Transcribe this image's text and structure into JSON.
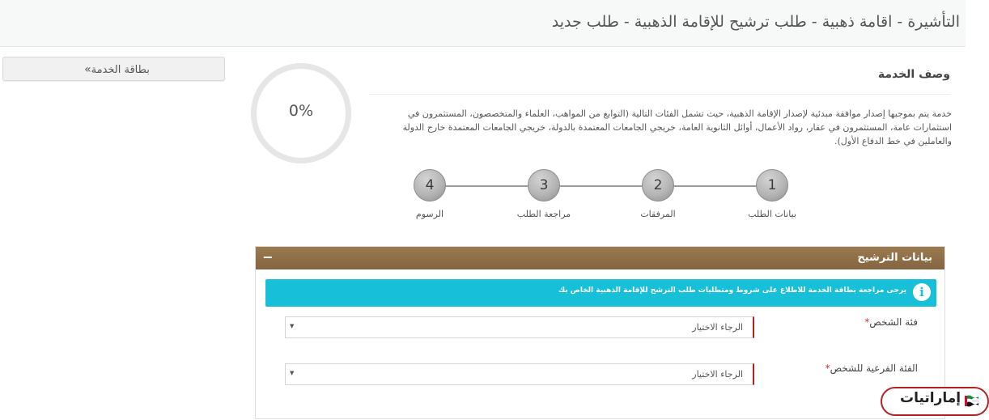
{
  "header": {
    "title": "التأشيرة - اقامة ذهبية - طلب ترشيح للإقامة الذهبية - طلب جديد"
  },
  "sidebar": {
    "service_card_label": "بطاقة الخدمة",
    "service_card_icon": "double-chevron-icon"
  },
  "progress": {
    "value_label": "0%",
    "fraction": 0
  },
  "description": {
    "title": "وصف الخدمة",
    "text": "خدمة يتم بموجبها إصدار موافقة مبدئية لإصدار الإقامة الذهبية، حيث تشمل الفئات التالية (التوابغ من المواهب، العلماء والمتخصصون، المستثمرون في استثمارات عامة، المستثمرون في عقار، رواد الأعمال، أوائل الثانوية العامة، خريجي الجامعات المعتمدة بالدولة، خريجي الجامعات المعتمدة خارج الدولة والعاملين في خط الدفاع الأول)."
  },
  "steps": [
    {
      "number": "1",
      "label": "بيانات الطلب"
    },
    {
      "number": "2",
      "label": "المرفقات"
    },
    {
      "number": "3",
      "label": "مراجعة الطلب"
    },
    {
      "number": "4",
      "label": "الرسوم"
    }
  ],
  "panel": {
    "title": "بيانات الترشيح",
    "toggle_label": "−",
    "header_color": "#8f6f48",
    "info": {
      "icon": "info-icon",
      "icon_glyph": "i",
      "text": "يرجى مراجعة بطاقة الخدمة للاطلاع على شروط ومتطلبات طلب الترشح للإقامة الذهبية الخاص بك",
      "color": "#17bfd8"
    },
    "fields": [
      {
        "label": "فئة الشخص",
        "required_mark": "*",
        "value": "الرجاء الاختيار"
      },
      {
        "label": "الفئة الفرعية للشخص",
        "required_mark": "*",
        "value": "الرجاء الاختيار"
      }
    ]
  },
  "watermark": {
    "text": "إماراتيات"
  }
}
